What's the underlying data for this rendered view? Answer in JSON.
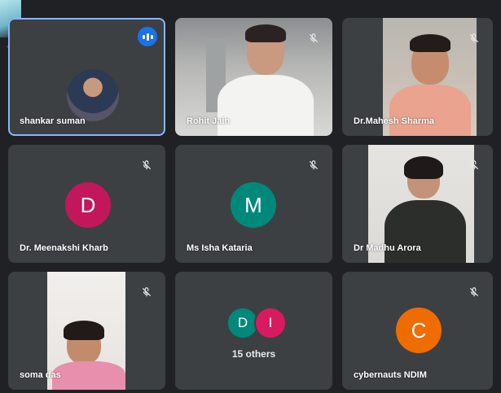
{
  "participants": [
    {
      "name": "shankar suman",
      "speaking": true,
      "active": true,
      "kind": "photo-avatar"
    },
    {
      "name": "Rohit Jain",
      "muted": true,
      "kind": "video"
    },
    {
      "name": "Dr.Mahesh Sharma",
      "muted": true,
      "kind": "video"
    },
    {
      "name": "Dr. Meenakshi Kharb",
      "muted": true,
      "kind": "letter",
      "initial": "D",
      "color": "#c2185b"
    },
    {
      "name": "Ms Isha Kataria",
      "muted": true,
      "kind": "letter",
      "initial": "M",
      "color": "#00897b"
    },
    {
      "name": "Dr Madhu Arora",
      "muted": true,
      "kind": "video"
    },
    {
      "name": "soma das",
      "muted": true,
      "kind": "video"
    },
    {
      "name": "15 others",
      "kind": "others",
      "avatars": [
        {
          "initial": "D",
          "color": "#00897b"
        },
        {
          "initial": "I",
          "color": "#d81b60"
        }
      ]
    },
    {
      "name": "cybernauts NDIM",
      "muted": true,
      "kind": "letter",
      "initial": "C",
      "color": "#ef6c00"
    }
  ],
  "icons": {
    "mute": "mic-off-icon",
    "speaking": "audio-level-icon"
  },
  "colors": {
    "background": "#202124",
    "tile": "#3c4043",
    "active_outline": "#8ab4f8",
    "speaking_badge": "#1a73e8"
  }
}
